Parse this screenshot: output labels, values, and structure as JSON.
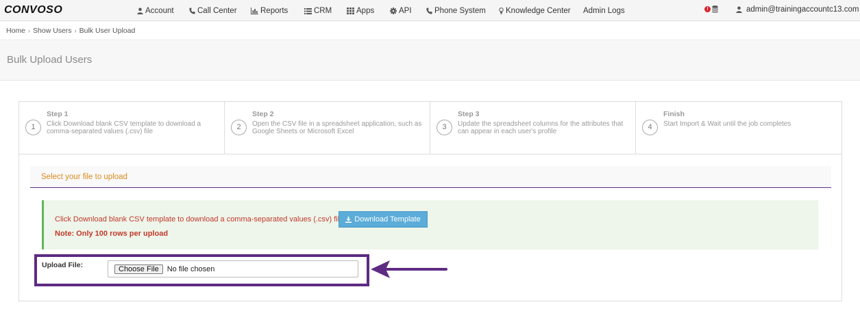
{
  "app": {
    "logo": "CONVOSO"
  },
  "nav": {
    "items": [
      {
        "label": "Account",
        "icon": "user-icon"
      },
      {
        "label": "Call Center",
        "icon": "phone-icon"
      },
      {
        "label": "Reports",
        "icon": "bar-chart-icon"
      },
      {
        "label": "CRM",
        "icon": "list-icon"
      },
      {
        "label": "Apps",
        "icon": "grid-icon"
      },
      {
        "label": "API",
        "icon": "gear-icon"
      },
      {
        "label": "Phone System",
        "icon": "phone-icon"
      },
      {
        "label": "Knowledge Center",
        "icon": "lightbulb-icon"
      },
      {
        "label": "Admin Logs",
        "icon": ""
      }
    ],
    "alert_badge": "!",
    "user_email": "admin@trainingaccountc13.com"
  },
  "breadcrumb": {
    "items": [
      "Home",
      "Show Users",
      "Bulk User Upload"
    ]
  },
  "page": {
    "title": "Bulk Upload Users"
  },
  "steps": [
    {
      "number": "1",
      "title": "Step 1",
      "description": "Click Download blank CSV template to download a comma-separated values (.csv) file"
    },
    {
      "number": "2",
      "title": "Step 2",
      "description": "Open the CSV file in a spreadsheet application, such as Google Sheets or Microsoft Excel"
    },
    {
      "number": "3",
      "title": "Step 3",
      "description": "Update the spreadsheet columns for the attributes that can appear in each user's profile"
    },
    {
      "number": "4",
      "title": "Finish",
      "description": "Start Import & Wait until the job completes"
    }
  ],
  "upload_section": {
    "heading": "Select your file to upload",
    "info_text": "Click Download blank CSV template to download a comma-separated values (.csv) file",
    "download_button": "Download Template",
    "note": "Note: Only 100 rows per upload",
    "upload_label": "Upload File:",
    "choose_button": "Choose File",
    "file_status": "No file chosen"
  },
  "colors": {
    "accent_purple": "#5e2b83",
    "heading_orange": "#d98a1e",
    "info_red": "#c0392b",
    "button_blue": "#5bacd8",
    "info_bg": "#eef5ea",
    "success_border": "#5cb85c"
  }
}
